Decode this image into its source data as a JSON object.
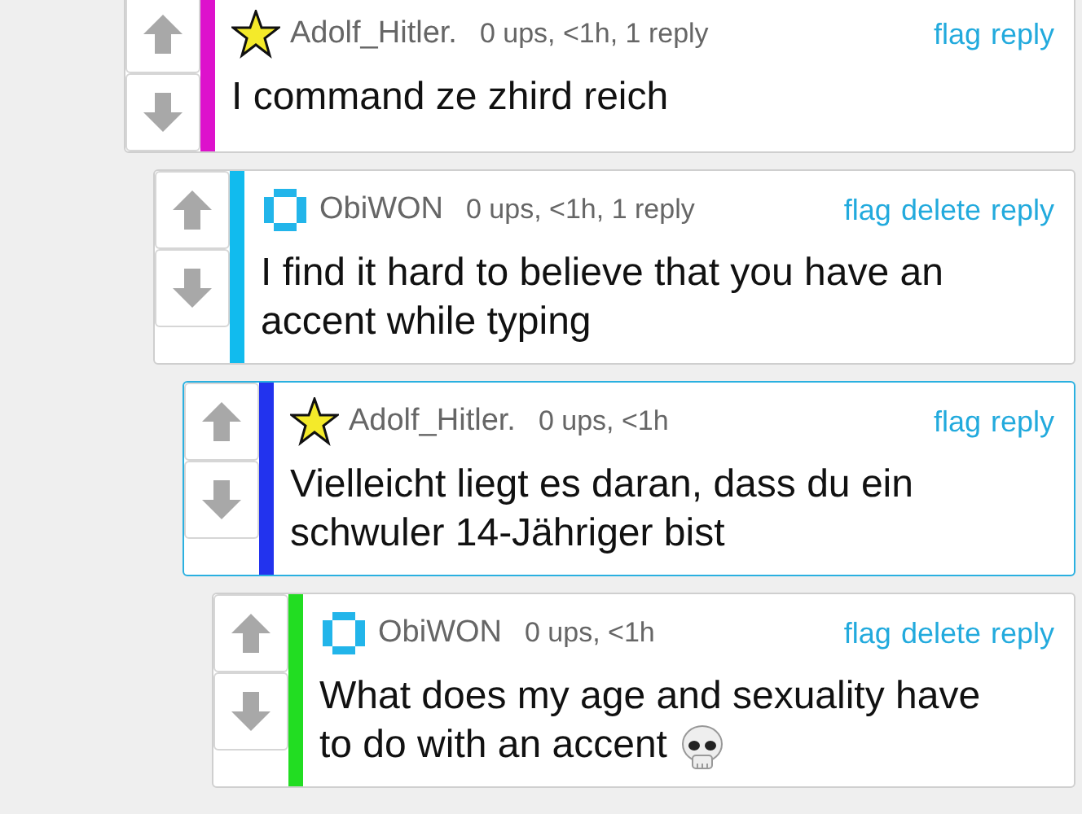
{
  "comments": [
    {
      "kind": "star",
      "username": "Adolf_Hitler.",
      "meta": "0 ups, <1h, 1 reply",
      "actions": [
        "flag",
        "reply"
      ],
      "text": "I command ze zhird reich",
      "color": "#dd11cc",
      "highlighted": false,
      "skull": false
    },
    {
      "kind": "ring",
      "username": "ObiWON",
      "meta": "0 ups, <1h, 1 reply",
      "actions": [
        "flag",
        "delete",
        "reply"
      ],
      "text": "I find it hard to believe that you have an accent while typing",
      "color": "#11bbee",
      "highlighted": false,
      "skull": false
    },
    {
      "kind": "star",
      "username": "Adolf_Hitler.",
      "meta": "0 ups, <1h",
      "actions": [
        "flag",
        "reply"
      ],
      "text": "Vielleicht liegt es daran, dass du ein schwuler 14-Jähriger bist",
      "color": "#2233ee",
      "highlighted": true,
      "skull": false
    },
    {
      "kind": "ring",
      "username": "ObiWON",
      "meta": "0 ups, <1h",
      "actions": [
        "flag",
        "delete",
        "reply"
      ],
      "text": "What does my age and sexuality have to do with an accent",
      "color": "#22dd22",
      "highlighted": false,
      "skull": true
    }
  ]
}
